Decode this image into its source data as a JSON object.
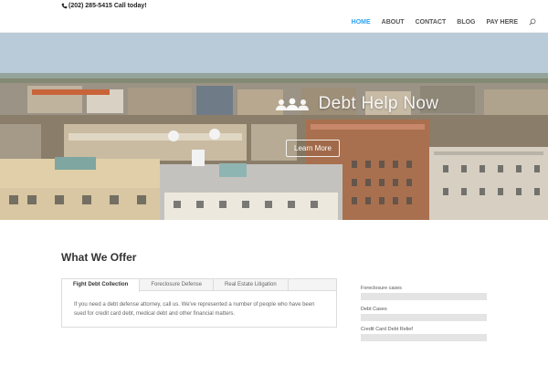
{
  "topbar": {
    "phone_text": "(202) 285-5415 Call today!"
  },
  "nav": {
    "items": [
      "HOME",
      "ABOUT",
      "CONTACT",
      "BLOG",
      "PAY HERE"
    ],
    "active": "HOME"
  },
  "hero": {
    "title": "Debt Help Now",
    "button_label": "Learn More"
  },
  "content": {
    "section_title": "What We Offer",
    "tabs": [
      "Fight Debt Collection",
      "Foreclosure Defense",
      "Real Estate Litigation"
    ],
    "active_tab": "Fight Debt Collection",
    "tab_body": "If you need a debt defense attorney, call us.  We've represented a number of people who have been sued for credit card debt, medical debt and other financial matters."
  },
  "progress_bars": [
    {
      "label": "Foreclosure cases",
      "fraction": 1.0
    },
    {
      "label": "Debt Cases",
      "fraction": 1.0
    },
    {
      "label": "Credit Card Debt Relief",
      "fraction": 1.0
    }
  ],
  "colors": {
    "accent": "#2ea3f2",
    "nav_text": "#555555"
  },
  "icons": {
    "phone": "phone-icon",
    "search": "search-icon",
    "hero": "group-icon"
  }
}
